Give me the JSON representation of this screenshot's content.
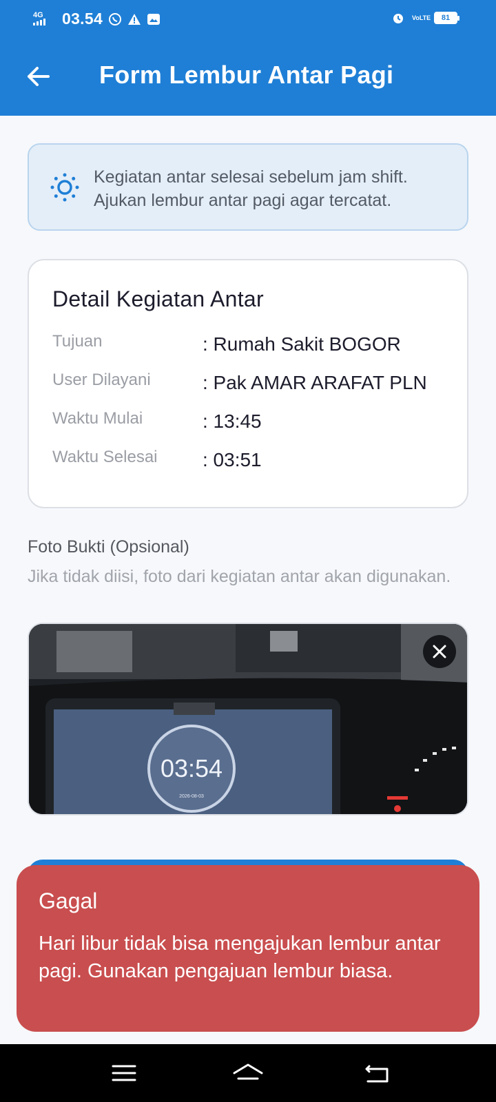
{
  "status_bar": {
    "signal": "4G",
    "time": "03.54",
    "network": "VoLTE",
    "battery": "81"
  },
  "app_bar": {
    "title": "Form Lembur Antar Pagi"
  },
  "info_banner": {
    "text": "Kegiatan antar selesai sebelum jam shift. Ajukan lembur antar pagi agar tercatat."
  },
  "detail_card": {
    "title": "Detail Kegiatan Antar",
    "rows": [
      {
        "label": "Tujuan",
        "value": ": Rumah Sakit BOGOR"
      },
      {
        "label": "User Dilayani",
        "value": ": Pak AMAR ARAFAT PLN"
      },
      {
        "label": "Waktu Mulai",
        "value": ": 13:45"
      },
      {
        "label": "Waktu Selesai",
        "value": ": 03:51"
      }
    ]
  },
  "photo_section": {
    "label": "Foto Bukti (Opsional)",
    "hint": "Jika tidak diisi, foto dari kegiatan antar akan digunakan.",
    "clock_time": "03:54",
    "clock_date": "2026-08-03"
  },
  "toast": {
    "title": "Gagal",
    "message": "Hari libur tidak bisa mengajukan lembur antar pagi. Gunakan pengajuan lembur biasa."
  },
  "colors": {
    "primary": "#1f7fd6",
    "error": "#c94e4f",
    "info_bg": "#e4eef8"
  },
  "icons": {
    "back": "arrow-left-icon",
    "info": "sun-icon",
    "remove_photo": "close-icon"
  }
}
